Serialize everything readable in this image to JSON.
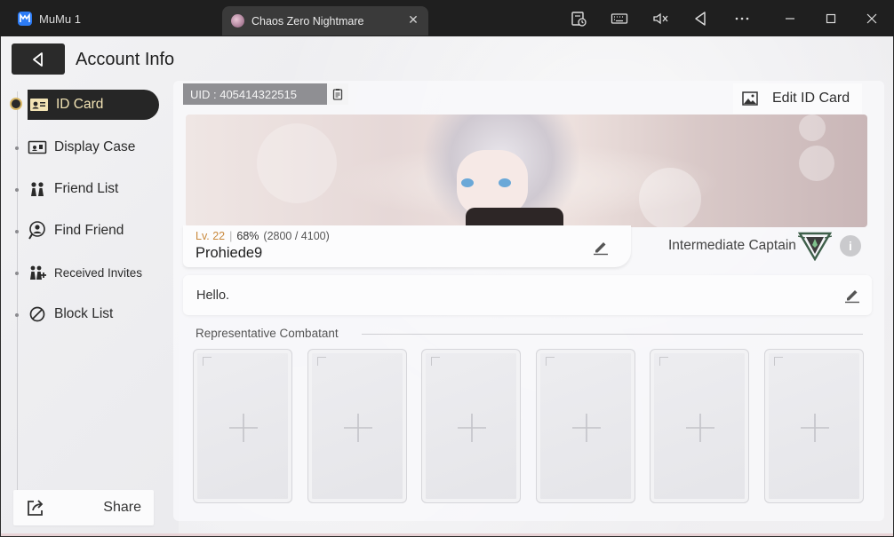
{
  "window": {
    "app_title": "MuMu 1",
    "game_tab_title": "Chaos Zero Nightmare",
    "tab_close": "✕",
    "toolbar_icons": [
      "screenshot-record-icon",
      "keyboard-icon",
      "mute-icon",
      "back-triangle-icon",
      "more-icon",
      "minimize-icon",
      "maximize-icon",
      "close-icon"
    ]
  },
  "header": {
    "title": "Account Info"
  },
  "sidebar": {
    "items": [
      {
        "label": "ID Card",
        "icon": "id-card-icon",
        "active": true
      },
      {
        "label": "Display Case",
        "icon": "display-case-icon",
        "active": false
      },
      {
        "label": "Friend List",
        "icon": "friends-icon",
        "active": false
      },
      {
        "label": "Find Friend",
        "icon": "find-friend-icon",
        "active": false
      },
      {
        "label": "Received Invites",
        "icon": "invites-icon",
        "active": false
      },
      {
        "label": "Block List",
        "icon": "block-icon",
        "active": false
      }
    ],
    "share_label": "Share"
  },
  "profile": {
    "uid": "UID : 405414322515",
    "edit_card_label": "Edit ID Card",
    "level": "Lv. 22",
    "exp_percent": "68%",
    "exp_values": "(2800 / 4100)",
    "player_name": "Prohiede9",
    "rank_title": "Intermediate Captain",
    "info_glyph": "i",
    "greeting": "Hello."
  },
  "combatants": {
    "title": "Representative Combatant",
    "slot_count": 6
  },
  "colors": {
    "level_accent": "#c9893d",
    "active_nav_bg": "#262626",
    "active_nav_text": "#f2e3b4",
    "uid_bg": "#8f8f93"
  }
}
